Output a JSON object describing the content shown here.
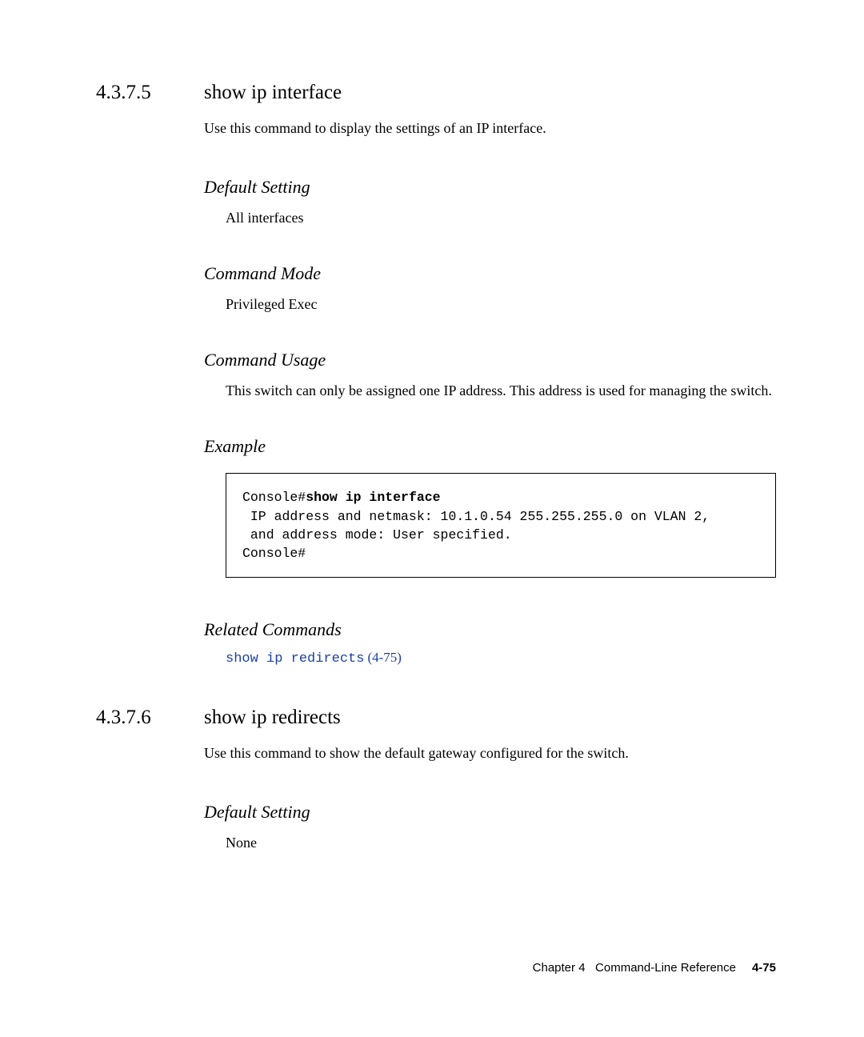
{
  "section1": {
    "number": "4.3.7.5",
    "title": "show ip interface",
    "intro": "Use this command to display the settings of an IP interface.",
    "defaultSetting": {
      "heading": "Default Setting",
      "text": "All interfaces"
    },
    "commandMode": {
      "heading": "Command Mode",
      "text": "Privileged Exec"
    },
    "commandUsage": {
      "heading": "Command Usage",
      "text": "This switch can only be assigned one IP address. This address is used for managing the switch."
    },
    "example": {
      "heading": "Example",
      "prompt1": "Console#",
      "command": "show ip interface",
      "line1": " IP address and netmask: 10.1.0.54 255.255.255.0 on VLAN 2,",
      "line2": " and address mode: User specified.",
      "prompt2": "Console#"
    },
    "related": {
      "heading": "Related Commands",
      "linkText": "show ip redirects",
      "pageRef": "(4-75)"
    }
  },
  "section2": {
    "number": "4.3.7.6",
    "title": "show ip redirects",
    "intro": "Use this command to show the default gateway configured for the switch.",
    "defaultSetting": {
      "heading": "Default Setting",
      "text": "None"
    }
  },
  "footer": {
    "chapter": "Chapter 4",
    "title": "Command-Line Reference",
    "page": "4-75"
  }
}
